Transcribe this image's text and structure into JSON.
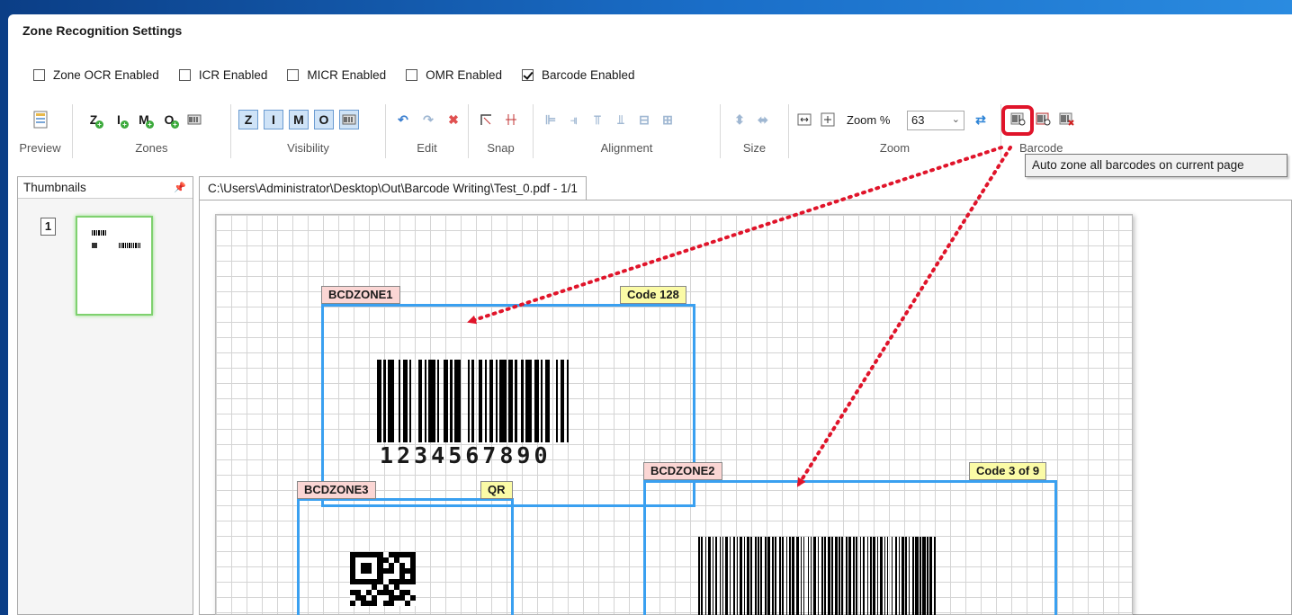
{
  "window": {
    "title": "Zone Recognition Settings"
  },
  "options": [
    {
      "label": "Zone OCR Enabled",
      "checked": false
    },
    {
      "label": "ICR Enabled",
      "checked": false
    },
    {
      "label": "MICR Enabled",
      "checked": false
    },
    {
      "label": "OMR Enabled",
      "checked": false
    },
    {
      "label": "Barcode Enabled",
      "checked": true
    }
  ],
  "ribbon": {
    "groups": [
      "Preview",
      "Zones",
      "Visibility",
      "Edit",
      "Snap",
      "Alignment",
      "Size",
      "Zoom",
      "Barcode"
    ],
    "zoom_label": "Zoom %",
    "zoom_value": "63",
    "zones_glyphs": [
      "Z",
      "I",
      "M",
      "O"
    ]
  },
  "tooltip": "Auto zone all barcodes on current page",
  "thumbnails": {
    "title": "Thumbnails",
    "page": "1"
  },
  "document": {
    "tab": "C:\\Users\\Administrator\\Desktop\\Out\\Barcode Writing\\Test_0.pdf - 1/1"
  },
  "zones": [
    {
      "name": "BCDZONE1",
      "type": "Code 128",
      "digits": "1234567890"
    },
    {
      "name": "BCDZONE3",
      "type": "QR"
    },
    {
      "name": "BCDZONE2",
      "type": "Code 3 of 9"
    }
  ],
  "colors": {
    "zone_border": "#3aa0f0",
    "highlight": "#e0142a",
    "name_tag": "#fbd6d4",
    "type_tag": "#fbfba6"
  }
}
